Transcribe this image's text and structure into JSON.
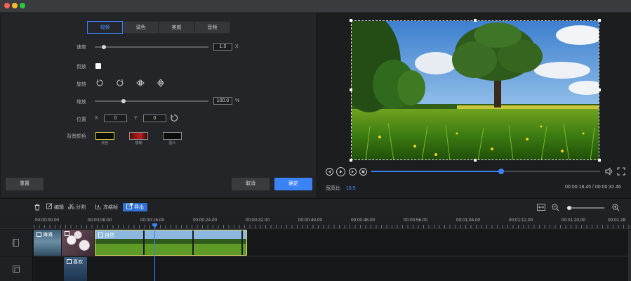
{
  "colors": {
    "accent": "#3b82f6",
    "panel": "#242528",
    "selected_swatch_border": "#d5c64a"
  },
  "edit_panel": {
    "tabs": [
      {
        "label": "视频",
        "active": true
      },
      {
        "label": "调色",
        "active": false
      },
      {
        "label": "美颜",
        "active": false
      },
      {
        "label": "音频",
        "active": false
      }
    ],
    "speed": {
      "label": "速度",
      "value": "1.0",
      "unit": "X",
      "slider_fraction": 0.08
    },
    "reverse": {
      "label": "倒放",
      "checked": false
    },
    "rotate": {
      "label": "旋转",
      "icons": [
        "rotate-left-icon",
        "rotate-right-icon",
        "flip-horizontal-icon",
        "flip-vertical-icon"
      ]
    },
    "scale": {
      "label": "缩放",
      "value": "100.0",
      "unit": "%",
      "slider_fraction": 0.25
    },
    "position": {
      "label": "位置",
      "x_label": "X",
      "x_value": "0",
      "y_label": "Y",
      "y_value": "0"
    },
    "background": {
      "label": "背景颜色",
      "options": [
        {
          "label": "纯色",
          "selected": true
        },
        {
          "label": "模糊",
          "selected": false
        },
        {
          "label": "图片",
          "selected": false
        }
      ]
    },
    "reset_label": "重置",
    "cancel_label": "取消",
    "confirm_label": "确定"
  },
  "preview": {
    "aspect_label": "宽高比",
    "aspect_value": "16:9",
    "current_time": "00:00:18.45",
    "separator": " / ",
    "total_time": "00:00:32.46",
    "progress_fraction": 0.568
  },
  "timeline": {
    "tools": {
      "edit": "编辑",
      "split": "分割",
      "freeze": "冻结帧",
      "export": "导出"
    },
    "zoom_fraction": 0.05,
    "ruler_labels": [
      "00:00:00.00",
      "00:00:08.00",
      "00:00:16.00",
      "00:00:24.00",
      "00:00:32.00",
      "00:00:40.00",
      "00:00:48.00",
      "00:00:56.00",
      "00:01:04.00",
      "00:01:12.00",
      "00:01:20.00",
      "00:01:28"
    ],
    "clips": {
      "clip1": "海滩",
      "clip3": "自然",
      "clip4": "喜欢"
    }
  }
}
